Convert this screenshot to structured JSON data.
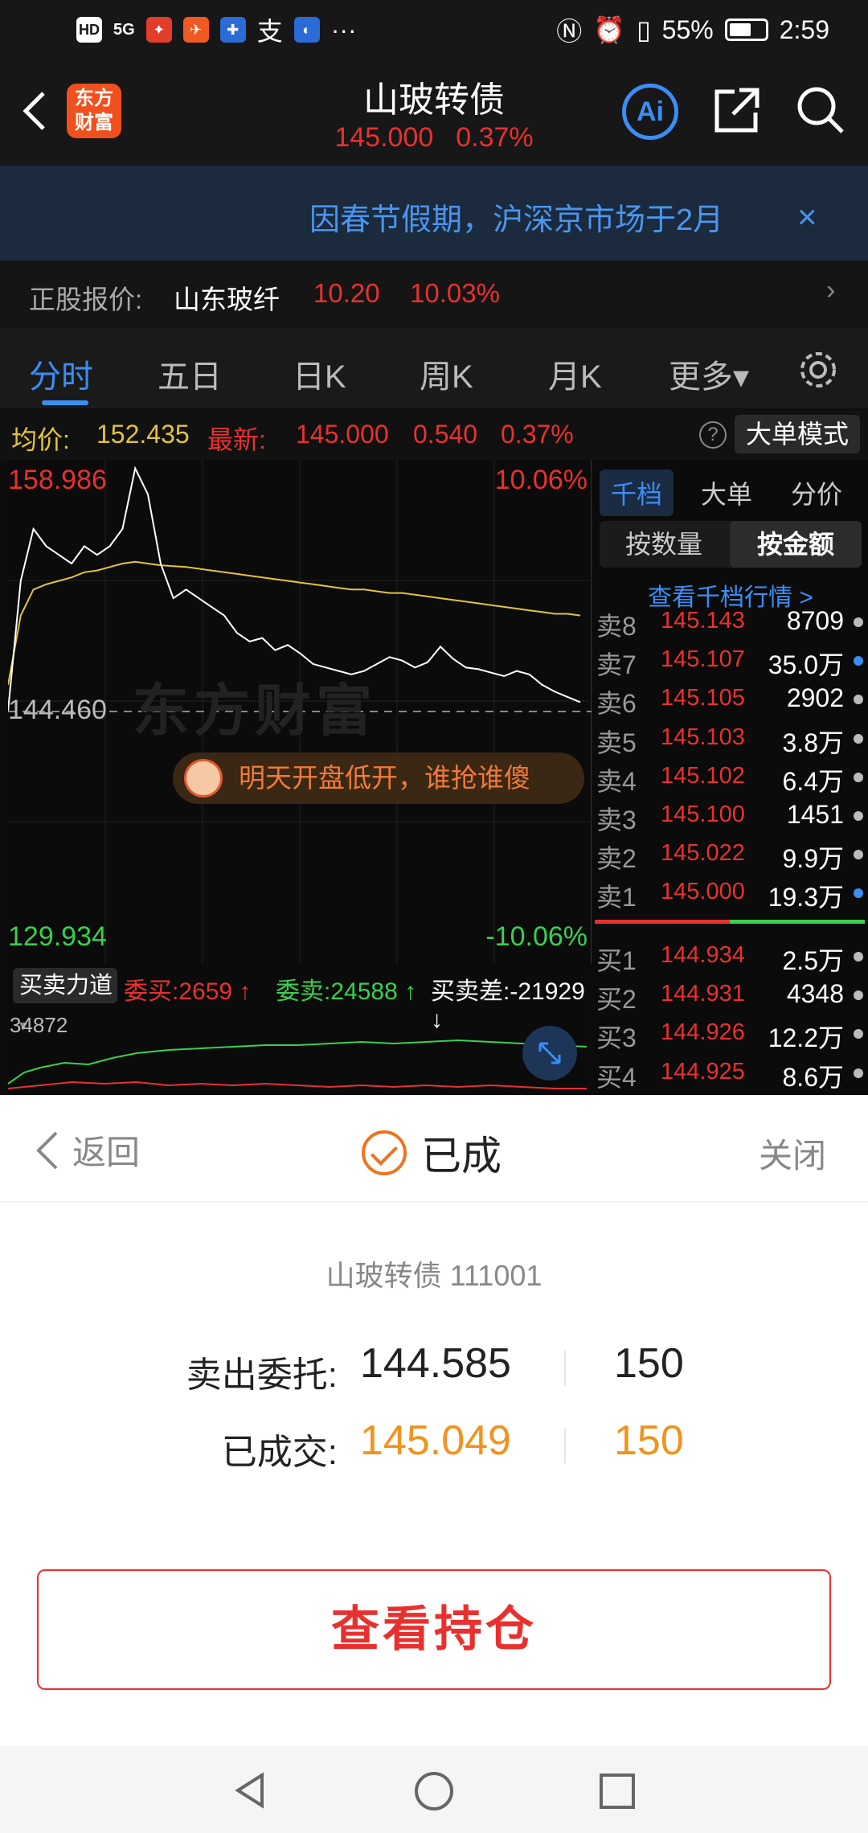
{
  "status": {
    "time": "2:59",
    "battery": "55%",
    "network": "5G",
    "more": "···",
    "pay_glyph": "支"
  },
  "header": {
    "logo": "东方财富",
    "title": "山玻转债",
    "price": "145.000",
    "change_pct": "0.37%",
    "ai_label": "Ai"
  },
  "notice": {
    "text": "因春节假期，沪深京市场于2月",
    "close": "×"
  },
  "quote": {
    "label": "正股报价:",
    "name": "山东玻纤",
    "price": "10.20",
    "pct": "10.03%",
    "arrow": "›"
  },
  "tabs": [
    "分时",
    "五日",
    "日K",
    "周K",
    "月K",
    "更多▾"
  ],
  "info": {
    "avg_label": "均价:",
    "avg": "152.435",
    "last_label": "最新:",
    "last": "145.000",
    "chg": "0.540",
    "pct": "0.37%",
    "help": "?",
    "mode": "大单模式"
  },
  "chart": {
    "high": "158.986",
    "high_pct": "10.06%",
    "base": "144.460",
    "low": "129.934",
    "low_pct": "-10.06%",
    "watermark": "东方财富",
    "tip": "明天开盘低开，谁抢谁傻"
  },
  "chart_data": {
    "type": "line",
    "ylim": [
      129.934,
      158.986
    ],
    "series": [
      {
        "values": [
          144.5,
          152,
          155,
          154,
          153.5,
          153,
          154,
          153.5,
          154,
          155,
          158.5,
          157,
          153,
          151,
          151.5,
          151,
          150.5,
          150,
          149,
          148.5,
          148.7,
          148,
          148.3,
          147.8,
          147.2,
          147,
          146.8,
          146.6,
          146.8,
          147.2,
          147.6,
          147.4,
          147,
          147.3,
          148.2,
          147.5,
          147,
          146.9,
          146.7,
          146.5,
          146.8,
          146.6,
          146,
          145.6,
          145.3,
          145
        ]
      },
      {
        "values": [
          146,
          150,
          151.5,
          151.8,
          152,
          152.2,
          152.5,
          152.6,
          152.8,
          153,
          153.1,
          153,
          152.9,
          152.85,
          152.8,
          152.7,
          152.6,
          152.5,
          152.4,
          152.3,
          152.2,
          152.1,
          152,
          151.9,
          151.8,
          151.7,
          151.6,
          151.5,
          151.5,
          151.4,
          151.3,
          151.3,
          151.2,
          151.1,
          151,
          150.9,
          150.8,
          150.7,
          150.6,
          150.5,
          150.4,
          150.3,
          150.2,
          150.1,
          150.1,
          150
        ]
      }
    ]
  },
  "indicator": {
    "name": "买卖力道",
    "buy": "委买:2659 ↑",
    "sell": "委卖:24588 ↑",
    "diff": "买卖差:-21929 ↓",
    "max": "34872"
  },
  "right": {
    "tabs": [
      "千档",
      "大单",
      "分价"
    ],
    "seg": [
      "按数量",
      "按金额"
    ],
    "more": "查看千档行情 >"
  },
  "asks": [
    {
      "n": "卖8",
      "p": "145.143",
      "v": "8709"
    },
    {
      "n": "卖7",
      "p": "145.107",
      "v": "35.0万"
    },
    {
      "n": "卖6",
      "p": "145.105",
      "v": "2902"
    },
    {
      "n": "卖5",
      "p": "145.103",
      "v": "3.8万"
    },
    {
      "n": "卖4",
      "p": "145.102",
      "v": "6.4万"
    },
    {
      "n": "卖3",
      "p": "145.100",
      "v": "1451"
    },
    {
      "n": "卖2",
      "p": "145.022",
      "v": "9.9万"
    },
    {
      "n": "卖1",
      "p": "145.000",
      "v": "19.3万"
    }
  ],
  "bids": [
    {
      "n": "买1",
      "p": "144.934",
      "v": "2.5万"
    },
    {
      "n": "买2",
      "p": "144.931",
      "v": "4348"
    },
    {
      "n": "买3",
      "p": "144.926",
      "v": "12.2万"
    },
    {
      "n": "买4",
      "p": "144.925",
      "v": "8.6万"
    }
  ],
  "sheet": {
    "back": "返回",
    "title": "已成",
    "close": "关闭",
    "code": "山玻转债 111001",
    "order_label": "卖出委托:",
    "order_price": "144.585",
    "order_qty": "150",
    "deal_label": "已成交:",
    "deal_price": "145.049",
    "deal_qty": "150",
    "button": "查看持仓"
  },
  "colors": {
    "up": "#e8312f",
    "down": "#39d04d",
    "accent": "#3a8ef5",
    "deal": "#f0931e"
  }
}
